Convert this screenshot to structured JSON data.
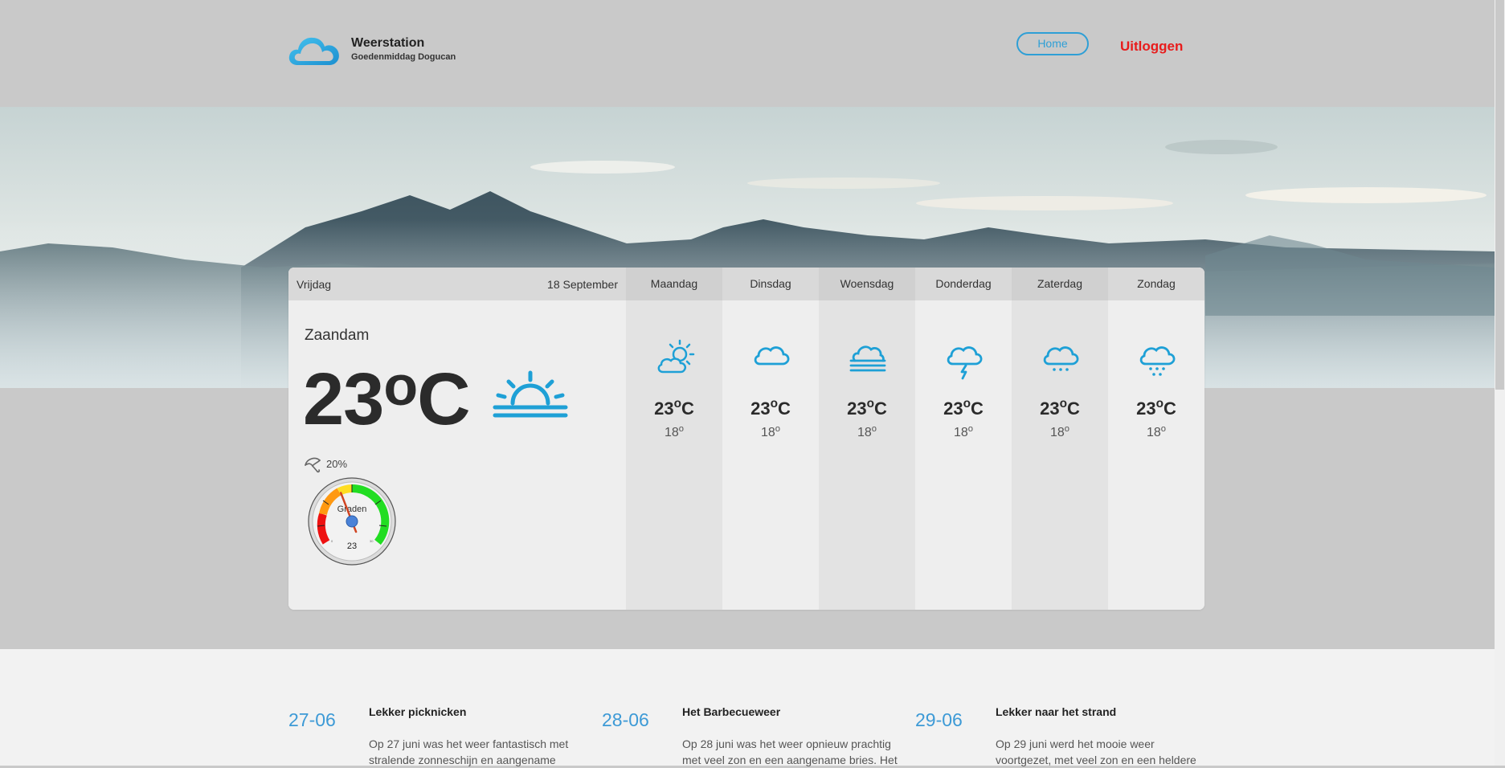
{
  "header": {
    "brand_title": "Weerstation",
    "brand_subtitle": "Goedenmiddag Dogucan",
    "home_label": "Home",
    "logout_label": "Uitloggen",
    "logo_icon": "cloud-icon"
  },
  "today": {
    "day": "Vrijdag",
    "date": "18 September",
    "city": "Zaandam",
    "temp": "23",
    "unit": "°C",
    "condition_icon": "sunrise-icon",
    "rain_icon": "umbrella-icon",
    "rain_chance": "20%",
    "gauge": {
      "label": "Graden",
      "value": "23",
      "value_number": 23,
      "min": 0,
      "max": 30
    }
  },
  "forecast": [
    {
      "day": "Maandag",
      "temp": "23",
      "unit": "°C",
      "low": "18",
      "low_unit": "°",
      "icon": "partly-cloudy-icon"
    },
    {
      "day": "Dinsdag",
      "temp": "23",
      "unit": "°C",
      "low": "18",
      "low_unit": "°",
      "icon": "cloud-icon"
    },
    {
      "day": "Woensdag",
      "temp": "23",
      "unit": "°C",
      "low": "18",
      "low_unit": "°",
      "icon": "fog-icon"
    },
    {
      "day": "Donderdag",
      "temp": "23",
      "unit": "°C",
      "low": "18",
      "low_unit": "°",
      "icon": "thunderstorm-icon"
    },
    {
      "day": "Zaterdag",
      "temp": "23",
      "unit": "°C",
      "low": "18",
      "low_unit": "°",
      "icon": "snow-icon"
    },
    {
      "day": "Zondag",
      "temp": "23",
      "unit": "°C",
      "low": "18",
      "low_unit": "°",
      "icon": "heavy-snow-icon"
    }
  ],
  "news": [
    {
      "date": "27-06",
      "title": "Lekker picknicken",
      "body": "Op 27 juni was het weer fantastisch met stralende zonneschijn en aangename"
    },
    {
      "date": "28-06",
      "title": "Het Barbecueweer",
      "body": "Op 28 juni was het weer opnieuw prachtig met veel zon en een aangename bries. Het"
    },
    {
      "date": "29-06",
      "title": "Lekker naar het strand",
      "body": "Op 29 juni werd het mooie weer voortgezet, met veel zon en een heldere"
    }
  ],
  "colors": {
    "accent": "#2e9fd6",
    "logout": "#e81c1c",
    "icon": "#1ea0d6"
  }
}
